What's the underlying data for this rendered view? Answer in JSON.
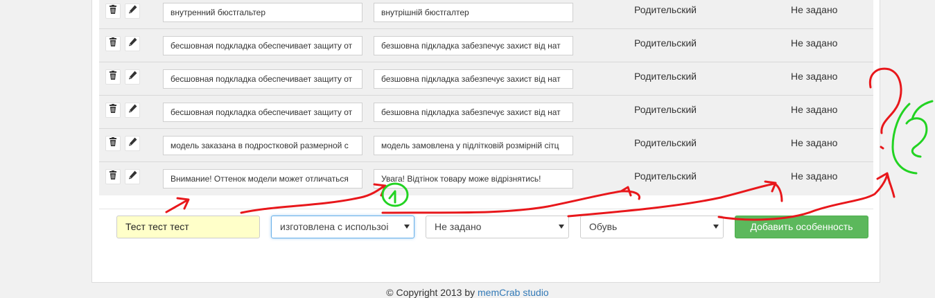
{
  "rows": [
    {
      "ru": "внутренний бюстгальтер",
      "ua": "внутрішній бюстгалтер",
      "type": "Родительский",
      "value": "Не задано"
    },
    {
      "ru": "бесшовная подкладка обеспечивает защиту от",
      "ua": "безшовна підкладка забезпечує захист від нат",
      "type": "Родительский",
      "value": "Не задано"
    },
    {
      "ru": "бесшовная подкладка обеспечивает защиту от",
      "ua": "безшовна підкладка забезпечує захист від нат",
      "type": "Родительский",
      "value": "Не задано"
    },
    {
      "ru": "бесшовная подкладка обеспечивает защиту от",
      "ua": "безшовна підкладка забезпечує захист від нат",
      "type": "Родительский",
      "value": "Не задано"
    },
    {
      "ru": "модель заказана в подростковой размерной с",
      "ua": "модель замовлена у підлітковій розмірній сітц",
      "type": "Родительский",
      "value": "Не задано"
    },
    {
      "ru": "Внимание! Оттенок модели может отличаться",
      "ua": "Увага! Відтінок товару може відрізнятись!",
      "type": "Родительский",
      "value": "Не задано"
    }
  ],
  "icons": {
    "delete": "trash-icon",
    "edit": "pencil-icon"
  },
  "form": {
    "name_value": "Тест тест тест",
    "select1_value": "изготовлена с использоі",
    "select2_value": "Не задано",
    "select3_value": "Обувь",
    "add_button": "Добавить особенность"
  },
  "footer": {
    "copyright": "© Copyright 2013 by ",
    "link": "memCrab studio"
  },
  "annotations": {
    "green_mark_near_input": "1",
    "green_mark_right": "2",
    "red_color": "#e8171b",
    "green_color": "#22d322"
  },
  "colors": {
    "success": "#5cb85c",
    "row_bg": "#f0f0f0",
    "highlight_input": "#ffffc9",
    "link": "#337ab7"
  }
}
